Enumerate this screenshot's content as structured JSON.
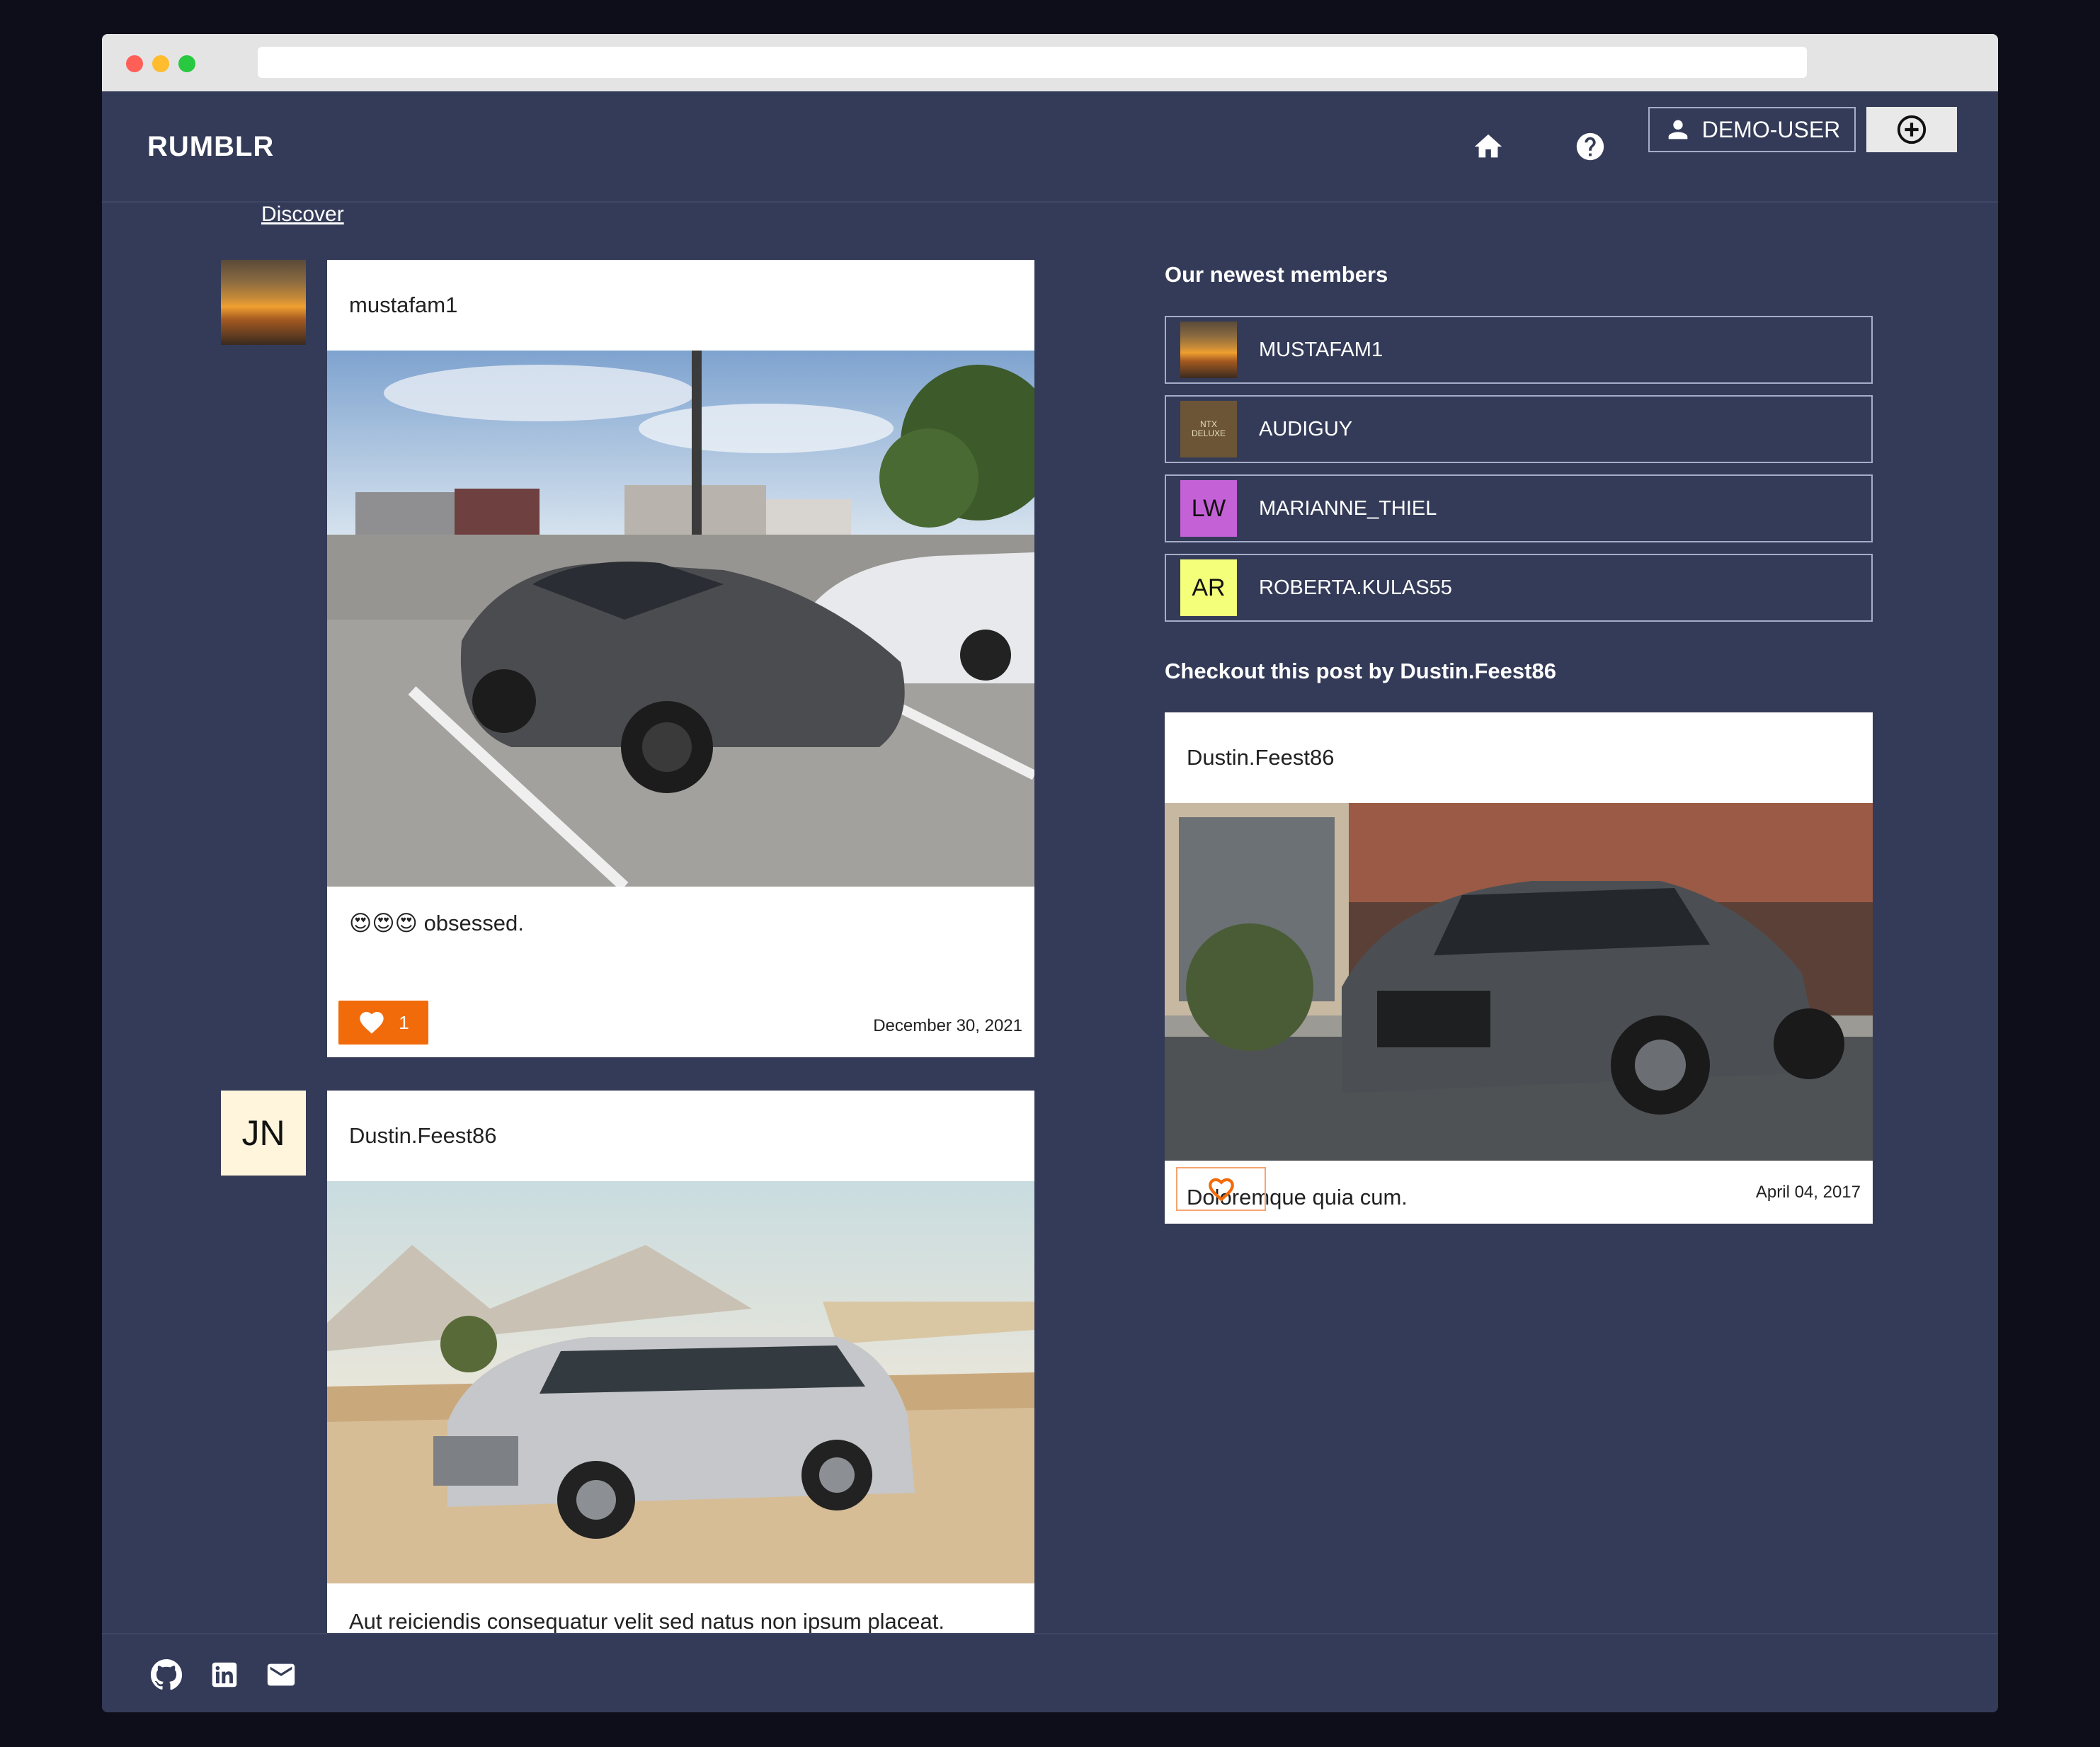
{
  "app": {
    "brand": "RUMBLR"
  },
  "nav": {
    "home_icon": "home-icon",
    "help_icon": "help-icon",
    "user_label": "DEMO-USER",
    "new_post_icon": "plus-circle-icon"
  },
  "page": {
    "discover_link": "Discover"
  },
  "feed": {
    "posts": [
      {
        "author": "mustafam1",
        "avatar": "sunset photo",
        "image": "dark grey Porsche Panamera parked in lot",
        "caption": "😍😍😍 obsessed.",
        "likes": "1",
        "liked": true,
        "date": "December 30, 2021"
      },
      {
        "author": "Dustin.Feest86",
        "avatar_initials": "JN",
        "image": "silver Lexus SUV on sand near tents",
        "caption": "Aut reiciendis consequatur velit sed natus non ipsum placeat."
      }
    ]
  },
  "sidebar": {
    "members_title": "Our newest members",
    "members": [
      {
        "name": "MUSTAFAM1",
        "avatar": "sunset photo"
      },
      {
        "name": "AUDIGUY",
        "avatar_text_line1": "NTX",
        "avatar_text_line2": "DELUXE",
        "avatar_color": "#6b5536"
      },
      {
        "name": "MARIANNE_THIEL",
        "avatar_initials": "LW",
        "avatar_color": "#c561d6"
      },
      {
        "name": "ROBERTA.KULAS55",
        "avatar_initials": "AR",
        "avatar_color": "#f4ff7a"
      }
    ],
    "featured_title": "Checkout this post by Dustin.Feest86",
    "featured_post": {
      "author": "Dustin.Feest86",
      "image": "dark grey Audi Q8 in front of brick building",
      "caption": "Doloremque quia cum.",
      "liked": false,
      "date": "April 04, 2017"
    }
  },
  "footer": {
    "icons": [
      "github-icon",
      "linkedin-icon",
      "mail-icon"
    ]
  },
  "colors": {
    "background": "#343b58",
    "accent": "#f26b0a",
    "card": "#ffffff"
  }
}
